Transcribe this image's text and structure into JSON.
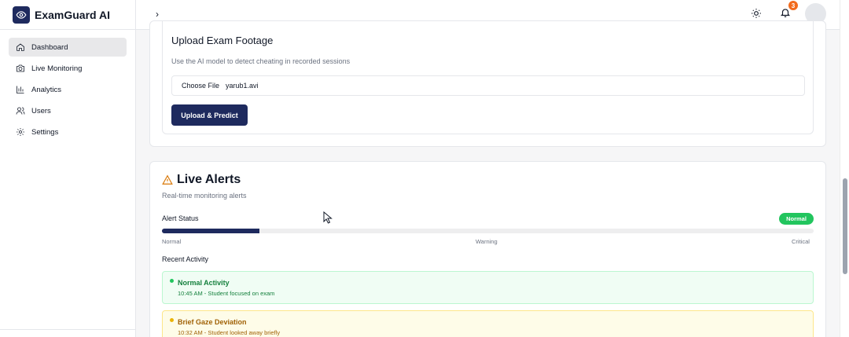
{
  "app": {
    "name": "ExamGuard AI"
  },
  "sidebar": {
    "items": [
      {
        "label": "Dashboard",
        "icon": "home-icon",
        "active": true
      },
      {
        "label": "Live Monitoring",
        "icon": "camera-icon",
        "active": false
      },
      {
        "label": "Analytics",
        "icon": "bar-chart-icon",
        "active": false
      },
      {
        "label": "Users",
        "icon": "users-icon",
        "active": false
      },
      {
        "label": "Settings",
        "icon": "gear-icon",
        "active": false
      }
    ]
  },
  "header": {
    "toggle_icon": "chevron-right-icon",
    "theme_icon": "sun-icon",
    "notifications_icon": "bell-icon",
    "notification_count": "3"
  },
  "upload": {
    "title": "Upload Exam Footage",
    "subtitle": "Use the AI model to detect cheating in recorded sessions",
    "choose_label": "Choose File",
    "file_name": "yarub1.avi",
    "button_label": "Upload & Predict"
  },
  "alerts": {
    "title": "Live Alerts",
    "subtitle": "Real-time monitoring alerts",
    "status_label": "Alert Status",
    "status_value": "Normal",
    "level_fraction": 0.15,
    "scale": {
      "low": "Normal",
      "mid": "Warning",
      "high": "Critical"
    },
    "recent_label": "Recent Activity",
    "activities": [
      {
        "title": "Normal Activity",
        "meta": "10:45 AM - Student focused on exam",
        "level": "normal"
      },
      {
        "title": "Brief Gaze Deviation",
        "meta": "10:32 AM - Student looked away briefly",
        "level": "warning"
      }
    ]
  },
  "colors": {
    "brand": "#1e2a5e",
    "success": "#22c55e",
    "warning": "#eab308",
    "badge": "#f26b1d"
  }
}
